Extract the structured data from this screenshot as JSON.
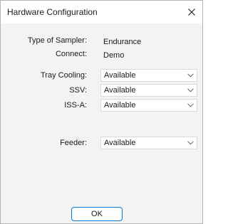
{
  "window": {
    "title": "Hardware Configuration",
    "close_icon": "close-icon"
  },
  "info": [
    {
      "label": "Type of Sampler:",
      "value": "Endurance"
    },
    {
      "label": "Connect:",
      "value": "Demo"
    }
  ],
  "options": [
    {
      "label": "Tray Cooling:",
      "value": "Available"
    },
    {
      "label": "SSV:",
      "value": "Available"
    },
    {
      "label": "ISS-A:",
      "value": "Available"
    },
    {
      "label": "Feeder:",
      "value": "Available"
    }
  ],
  "footer": {
    "ok_label": "OK"
  },
  "colors": {
    "accent": "#0078d4",
    "dialog_bg": "#f3f3f3",
    "field_bg": "#ffffff"
  }
}
